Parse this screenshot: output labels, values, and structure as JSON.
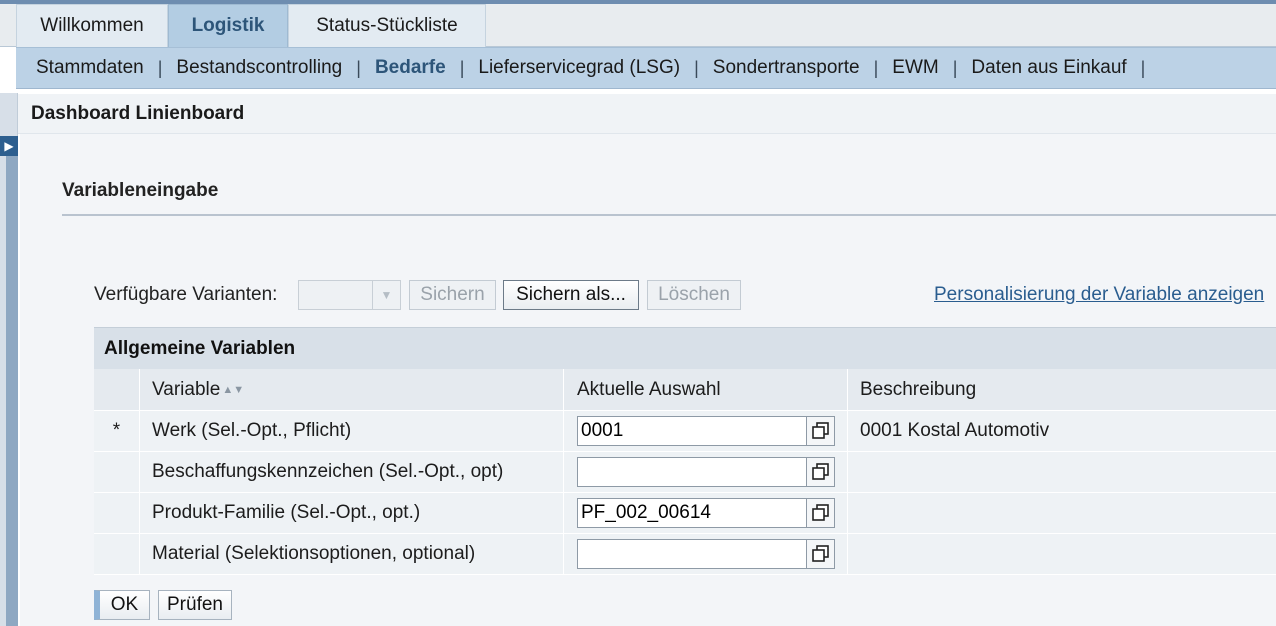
{
  "tabs_level1": [
    {
      "label": "Willkommen",
      "active": false
    },
    {
      "label": "Logistik",
      "active": true
    },
    {
      "label": "Status-Stückliste",
      "active": false
    }
  ],
  "tabs_level2": [
    {
      "label": "Stammdaten",
      "active": false
    },
    {
      "label": "Bestandscontrolling",
      "active": false
    },
    {
      "label": "Bedarfe",
      "active": true
    },
    {
      "label": "Lieferservicegrad (LSG)",
      "active": false
    },
    {
      "label": "Sondertransporte",
      "active": false
    },
    {
      "label": "EWM",
      "active": false
    },
    {
      "label": "Daten aus Einkauf",
      "active": false
    }
  ],
  "page_title": "Dashboard Linienboard",
  "section_title": "Variableneingabe",
  "variants": {
    "label": "Verfügbare Varianten:",
    "selected": "",
    "save_label": "Sichern",
    "save_as_label": "Sichern als...",
    "delete_label": "Löschen"
  },
  "personalization_link": "Personalisierung der Variable anzeigen",
  "group_title": "Allgemeine Variablen",
  "table": {
    "headers": [
      "Variable",
      "Aktuelle Auswahl",
      "Beschreibung"
    ],
    "rows": [
      {
        "required": "*",
        "variable": "Werk (Sel.-Opt., Pflicht)",
        "value": "0001",
        "description": "0001 Kostal Automotiv"
      },
      {
        "required": "",
        "variable": "Beschaffungskennzeichen (Sel.-Opt., opt)",
        "value": "",
        "description": ""
      },
      {
        "required": "",
        "variable": "Produkt-Familie (Sel.-Opt., opt.)",
        "value": "PF_002_00614",
        "description": ""
      },
      {
        "required": "",
        "variable": "Material (Selektionsoptionen, optional)",
        "value": "",
        "description": ""
      }
    ]
  },
  "actions": {
    "ok_label": "OK",
    "check_label": "Prüfen"
  },
  "colors": {
    "active_tab": "#b3cde3",
    "subbar": "#bcd2e6",
    "link": "#2a5d8f",
    "ok_button_accent": "#8fb3d6"
  }
}
